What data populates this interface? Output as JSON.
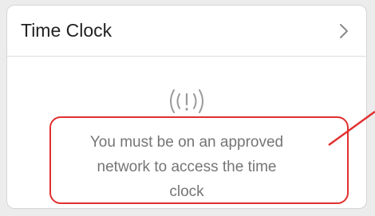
{
  "card": {
    "title": "Time Clock",
    "chevron_icon": "chevron-right-icon"
  },
  "status": {
    "icon": "network-signal-alert-icon",
    "icon_text": "((!))",
    "message_lines": [
      "You must be on an approved",
      "network to access the time",
      "clock"
    ]
  },
  "annotation": {
    "color": "#e0302f"
  }
}
